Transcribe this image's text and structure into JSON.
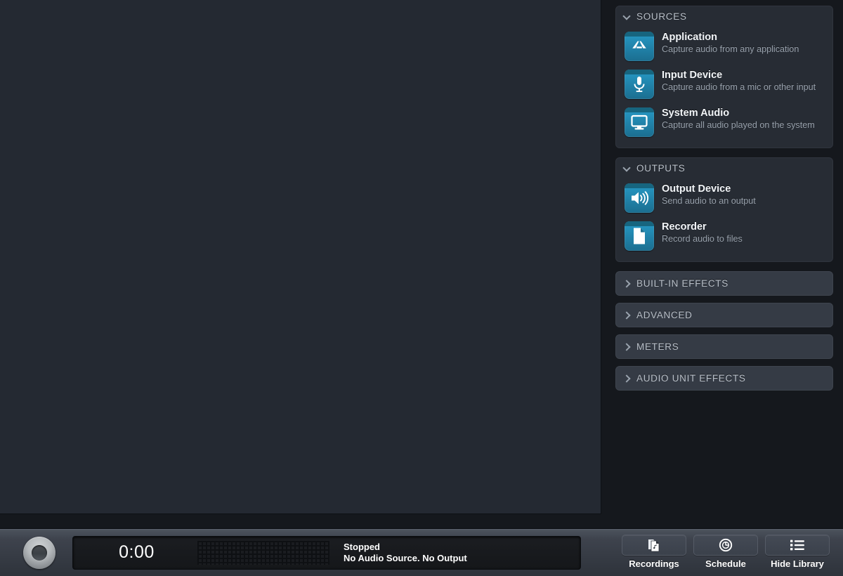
{
  "app": {
    "theme_bg": "#15181d",
    "canvas_bg": "#242932",
    "accent": "#2593be"
  },
  "library": {
    "groups": [
      {
        "id": "sources",
        "title": "SOURCES",
        "collapsed": false,
        "chevron": "chevron-down-icon",
        "items": [
          {
            "title": "Application",
            "desc": "Capture audio from any application",
            "icon": "application-icon"
          },
          {
            "title": "Input Device",
            "desc": "Capture audio from a mic or other input",
            "icon": "microphone-icon"
          },
          {
            "title": "System Audio",
            "desc": "Capture all audio played on the system",
            "icon": "monitor-icon"
          }
        ]
      },
      {
        "id": "outputs",
        "title": "OUTPUTS",
        "collapsed": false,
        "chevron": "chevron-down-icon",
        "items": [
          {
            "title": "Output Device",
            "desc": "Send audio to an output",
            "icon": "speaker-icon"
          },
          {
            "title": "Recorder",
            "desc": "Record audio to files",
            "icon": "document-icon"
          }
        ]
      },
      {
        "id": "built-in-effects",
        "title": "BUILT-IN EFFECTS",
        "collapsed": true,
        "chevron": "chevron-right-icon",
        "items": []
      },
      {
        "id": "advanced",
        "title": "ADVANCED",
        "collapsed": true,
        "chevron": "chevron-right-icon",
        "items": []
      },
      {
        "id": "meters",
        "title": "METERS",
        "collapsed": true,
        "chevron": "chevron-right-icon",
        "items": []
      },
      {
        "id": "audio-unit-effects",
        "title": "AUDIO UNIT EFFECTS",
        "collapsed": true,
        "chevron": "chevron-right-icon",
        "items": []
      }
    ]
  },
  "toolbar": {
    "record_button": "record-button",
    "lcd": {
      "time": "0:00",
      "status_line1": "Stopped",
      "status_line2": "No Audio Source. No Output",
      "meter": "level-meter"
    },
    "buttons": [
      {
        "label": "Recordings",
        "icon": "recordings-icon"
      },
      {
        "label": "Schedule",
        "icon": "clock-icon"
      },
      {
        "label": "Hide Library",
        "icon": "list-icon"
      }
    ]
  }
}
